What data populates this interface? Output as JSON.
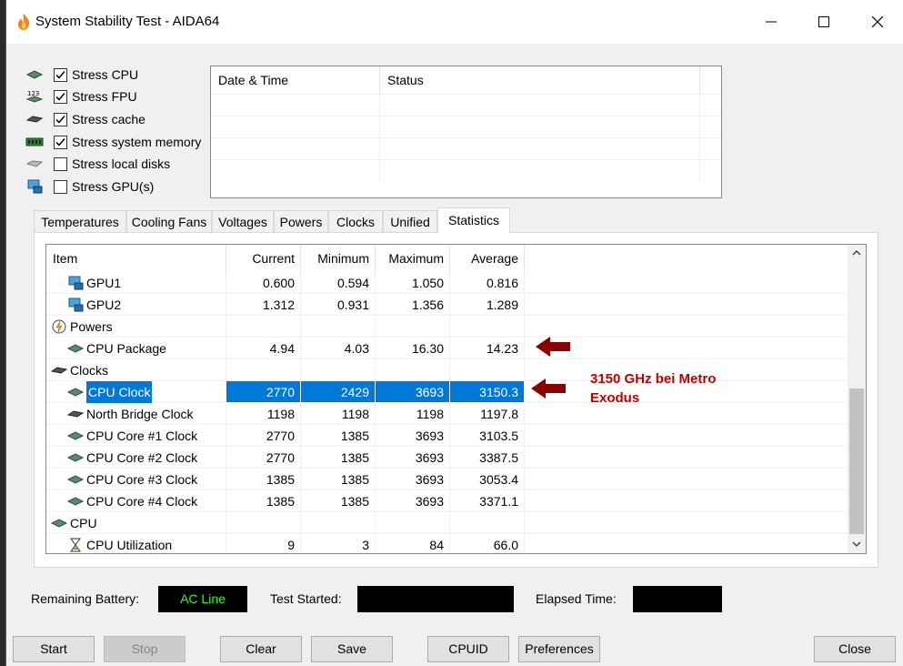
{
  "window": {
    "title": "System Stability Test - AIDA64"
  },
  "stress_options": [
    {
      "label": "Stress CPU",
      "checked": true,
      "icon": "cpu-chip-icon"
    },
    {
      "label": "Stress FPU",
      "checked": true,
      "icon": "fpu-123-icon"
    },
    {
      "label": "Stress cache",
      "checked": true,
      "icon": "cache-chip-icon"
    },
    {
      "label": "Stress system memory",
      "checked": true,
      "icon": "memory-module-icon"
    },
    {
      "label": "Stress local disks",
      "checked": false,
      "icon": "disk-drive-icon"
    },
    {
      "label": "Stress GPU(s)",
      "checked": false,
      "icon": "gpu-monitor-icon"
    }
  ],
  "log_table": {
    "columns": [
      "Date & Time",
      "Status"
    ]
  },
  "tabs": [
    "Temperatures",
    "Cooling Fans",
    "Voltages",
    "Powers",
    "Clocks",
    "Unified",
    "Statistics"
  ],
  "active_tab": "Statistics",
  "stats": {
    "columns": [
      "Item",
      "Current",
      "Minimum",
      "Maximum",
      "Average"
    ],
    "rows": [
      {
        "item": "GPU1",
        "icon": "gpu-monitor-icon",
        "indent": 1,
        "current": "0.600",
        "minimum": "0.594",
        "maximum": "1.050",
        "average": "0.816"
      },
      {
        "item": "GPU2",
        "icon": "gpu-monitor-icon",
        "indent": 1,
        "current": "1.312",
        "minimum": "0.931",
        "maximum": "1.356",
        "average": "1.289"
      },
      {
        "item": "Powers",
        "icon": "power-icon",
        "indent": 0,
        "current": "",
        "minimum": "",
        "maximum": "",
        "average": ""
      },
      {
        "item": "CPU Package",
        "icon": "cpu-chip-icon",
        "indent": 1,
        "current": "4.94",
        "minimum": "4.03",
        "maximum": "16.30",
        "average": "14.23"
      },
      {
        "item": "Clocks",
        "icon": "clock-chip-icon",
        "indent": 0,
        "current": "",
        "minimum": "",
        "maximum": "",
        "average": ""
      },
      {
        "item": "CPU Clock",
        "icon": "cpu-chip-icon",
        "indent": 1,
        "current": "2770",
        "minimum": "2429",
        "maximum": "3693",
        "average": "3150.3",
        "selected": true
      },
      {
        "item": "North Bridge Clock",
        "icon": "chipset-icon",
        "indent": 1,
        "current": "1198",
        "minimum": "1198",
        "maximum": "1198",
        "average": "1197.8"
      },
      {
        "item": "CPU Core #1 Clock",
        "icon": "cpu-chip-icon",
        "indent": 1,
        "current": "2770",
        "minimum": "1385",
        "maximum": "3693",
        "average": "3103.5"
      },
      {
        "item": "CPU Core #2 Clock",
        "icon": "cpu-chip-icon",
        "indent": 1,
        "current": "2770",
        "minimum": "1385",
        "maximum": "3693",
        "average": "3387.5"
      },
      {
        "item": "CPU Core #3 Clock",
        "icon": "cpu-chip-icon",
        "indent": 1,
        "current": "1385",
        "minimum": "1385",
        "maximum": "3693",
        "average": "3053.4"
      },
      {
        "item": "CPU Core #4 Clock",
        "icon": "cpu-chip-icon",
        "indent": 1,
        "current": "1385",
        "minimum": "1385",
        "maximum": "3693",
        "average": "3371.1"
      },
      {
        "item": "CPU",
        "icon": "cpu-chip-icon",
        "indent": 0,
        "current": "",
        "minimum": "",
        "maximum": "",
        "average": ""
      },
      {
        "item": "CPU Utilization",
        "icon": "hourglass-icon",
        "indent": 1,
        "current": "9",
        "minimum": "3",
        "maximum": "84",
        "average": "66.0"
      }
    ]
  },
  "annotation": {
    "text": "3150 GHz bei Metro Exodus",
    "color": "#c00000"
  },
  "status": {
    "battery_label": "Remaining Battery:",
    "battery_value": "AC Line",
    "test_started_label": "Test Started:",
    "test_started_value": "",
    "elapsed_label": "Elapsed Time:",
    "elapsed_value": ""
  },
  "buttons": {
    "start": "Start",
    "stop": "Stop",
    "clear": "Clear",
    "save": "Save",
    "cpuid": "CPUID",
    "preferences": "Preferences",
    "close": "Close"
  },
  "colors": {
    "selection": "#0078d7",
    "status_text": "#22ff22",
    "annotation": "#c00000"
  }
}
